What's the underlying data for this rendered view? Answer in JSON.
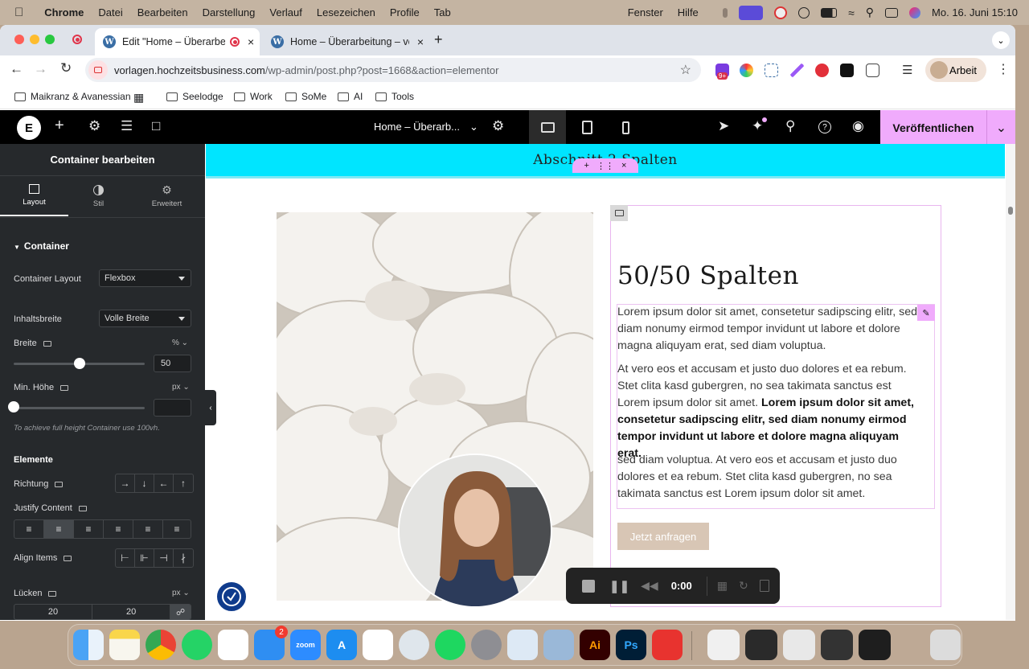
{
  "menubar": {
    "items": [
      "Chrome",
      "Datei",
      "Bearbeiten",
      "Darstellung",
      "Verlauf",
      "Lesezeichen",
      "Profile",
      "Tab",
      "Fenster",
      "Hilfe"
    ],
    "clock": "Mo. 16. Juni  15:10"
  },
  "browser": {
    "tabs": [
      {
        "label": "Edit \"Home – Überarbeitu"
      },
      {
        "label": "Home – Überarbeitung – vorl"
      }
    ],
    "url_host": "vorlagen.hochzeitsbusiness.com",
    "url_path": "/wp-admin/post.php?post=1668&action=elementor",
    "ext_badge": "9+",
    "profile_label": "Arbeit",
    "bookmarks": [
      "Maikranz & Avanessian",
      "Seelodge",
      "Work",
      "SoMe",
      "AI",
      "Tools"
    ]
  },
  "elementor": {
    "page_title": "Home – Überarb...",
    "publish_label": "Veröffentlichen"
  },
  "panel": {
    "title": "Container bearbeiten",
    "tabs": [
      "Layout",
      "Stil",
      "Erweitert"
    ],
    "section_container": "Container",
    "container_layout_label": "Container Layout",
    "container_layout_value": "Flexbox",
    "content_width_label": "Inhaltsbreite",
    "content_width_value": "Volle Breite",
    "width_label": "Breite",
    "width_unit": "%",
    "width_value": "50",
    "width_fraction": 0.5,
    "min_height_label": "Min. Höhe",
    "min_height_unit": "px",
    "min_height_value": "",
    "min_height_hint": "To achieve full height Container use 100vh.",
    "section_elements": "Elemente",
    "direction_label": "Richtung",
    "direction_glyphs": [
      "→",
      "↓",
      "←",
      "↑"
    ],
    "justify_label": "Justify Content",
    "align_label": "Align Items",
    "gaps_label": "Lücken",
    "gaps_unit": "px",
    "gap_col": "20",
    "gap_row": "20"
  },
  "canvas": {
    "section_title": "Abschnitt 2 Spalten",
    "heading": "50/50 Spalten",
    "para1": "Lorem ipsum dolor sit amet, consetetur sadipscing elitr, sed diam nonumy eirmod tempor invidunt ut labore et dolore magna aliquyam erat, sed diam voluptua.",
    "para2_plain": "At vero eos et accusam et justo duo dolores et ea rebum. Stet clita kasd gubergren, no sea takimata sanctus est Lorem ipsum dolor sit amet. ",
    "para2_bold": "Lorem ipsum dolor sit amet, consetetur sadipscing elitr, sed diam nonumy eirmod tempor invidunt ut labore et dolore magna aliquyam erat.",
    "para3": "sed diam voluptua. At vero eos et accusam et justo duo dolores et ea rebum. Stet clita kasd gubergren, no sea takimata sanctus est Lorem ipsum dolor sit amet.",
    "cta_label": "Jetzt anfragen"
  },
  "recorder": {
    "time": "0:00"
  },
  "dock": {
    "mail_badge": "2"
  },
  "colors": {
    "accent_pink": "#f0abfc",
    "section_cyan": "#00e5ff",
    "cta_beige": "#d8c6b5",
    "panel_dark": "#26292c"
  }
}
